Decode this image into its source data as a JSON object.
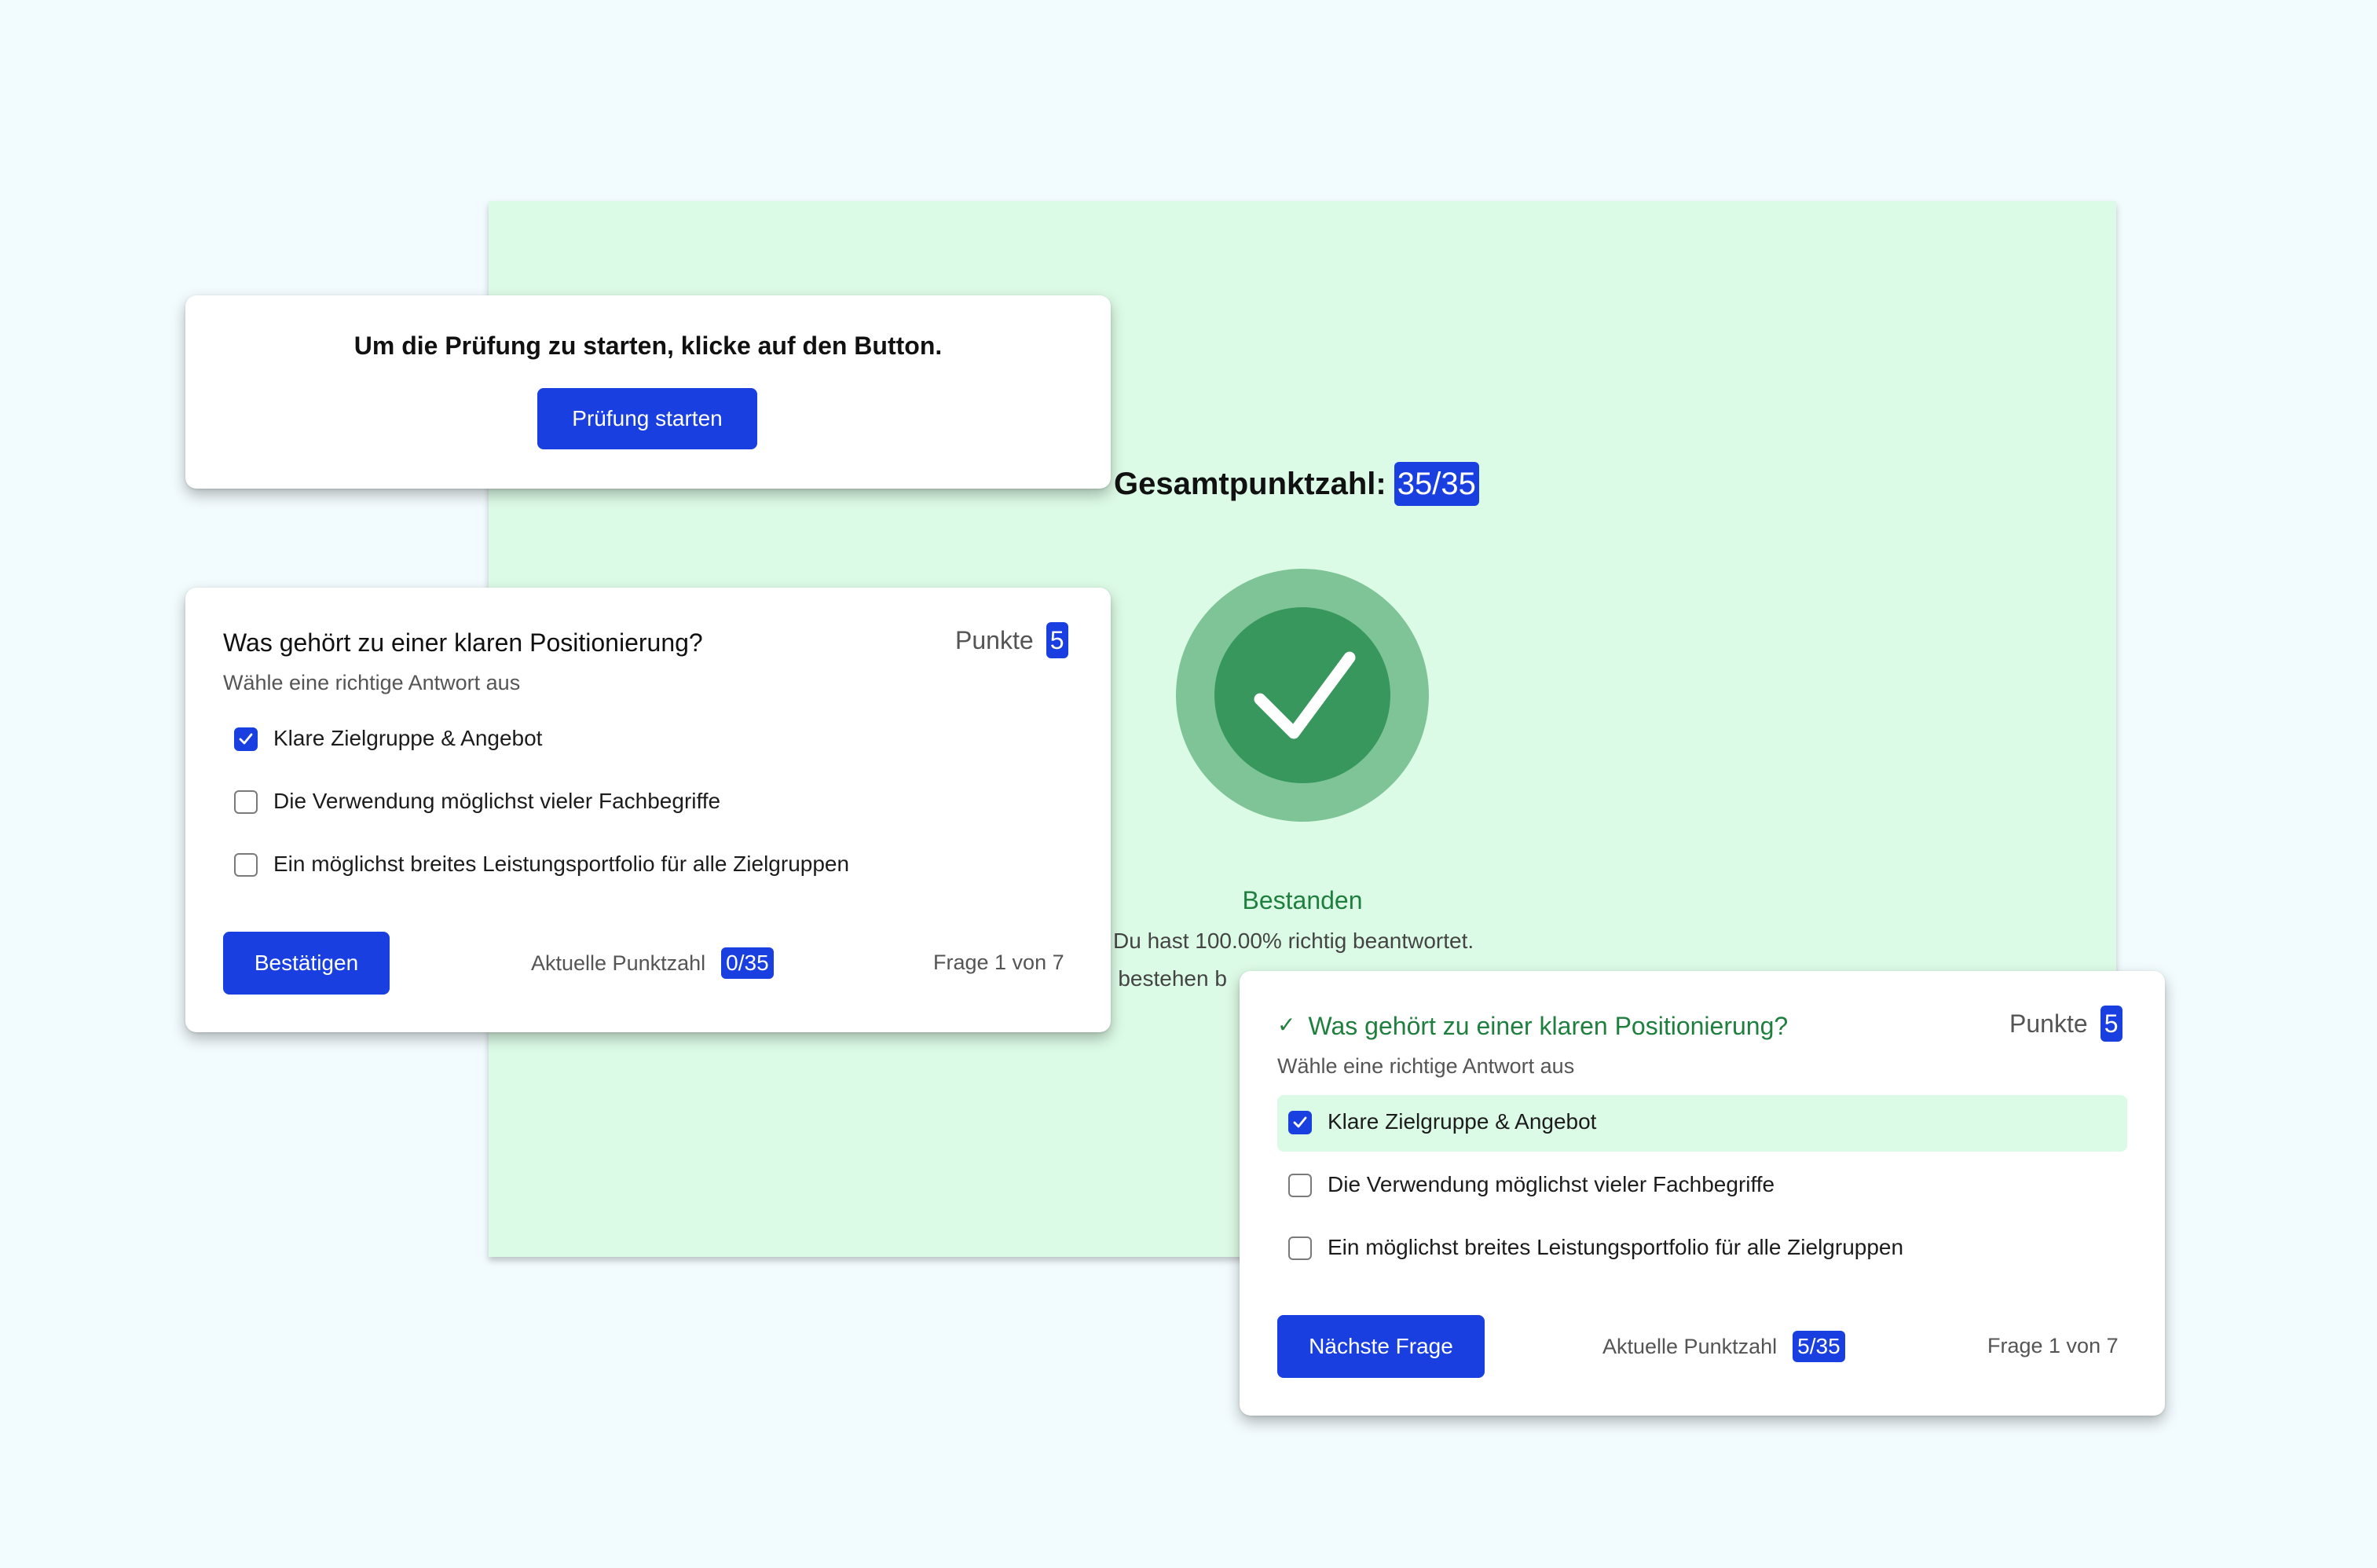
{
  "result": {
    "total_label": "Gesamtpunktzahl:",
    "total_score": "35/35",
    "status": "Bestanden",
    "percent_text": "Du hast 100.00% richtig beantwortet.",
    "partial_text": "u bestehen b",
    "colors": {
      "panel_bg": "#dcfbe6",
      "ring": "#7fc497",
      "circle": "#37975c",
      "status": "#1f7f3e"
    }
  },
  "start": {
    "message": "Um die Prüfung zu starten, klicke auf den Button.",
    "button_label": "Prüfung starten"
  },
  "question_unanswered": {
    "title": "Was gehört zu einer klaren Positionierung?",
    "subtitle": "Wähle eine richtige Antwort aus",
    "points_label": "Punkte",
    "points_value": "5",
    "options": [
      {
        "label": "Klare Zielgruppe & Angebot",
        "checked": true
      },
      {
        "label": "Die Verwendung möglichst vieler Fachbegriffe",
        "checked": false
      },
      {
        "label": "Ein möglichst breites Leistungsportfolio für alle Zielgruppen",
        "checked": false
      }
    ],
    "confirm_label": "Bestätigen",
    "current_score_label": "Aktuelle Punktzahl",
    "current_score": "0/35",
    "progress_text": "Frage 1 von 7"
  },
  "question_answered": {
    "check_symbol": "✓",
    "title": "Was gehört zu einer klaren Positionierung?",
    "subtitle": "Wähle eine richtige Antwort aus",
    "points_label": "Punkte",
    "points_value": "5",
    "options": [
      {
        "label": "Klare Zielgruppe & Angebot",
        "checked": true,
        "correct": true
      },
      {
        "label": "Die Verwendung möglichst vieler Fachbegriffe",
        "checked": false
      },
      {
        "label": "Ein möglichst breites Leistungsportfolio für alle Zielgruppen",
        "checked": false
      }
    ],
    "next_label": "Nächste Frage",
    "current_score_label": "Aktuelle Punktzahl",
    "current_score": "5/35",
    "progress_text": "Frage 1 von 7"
  },
  "colors": {
    "accent": "#1a3fe0",
    "correct_bg": "#dcfbe6",
    "correct_text": "#1f7f3e"
  }
}
